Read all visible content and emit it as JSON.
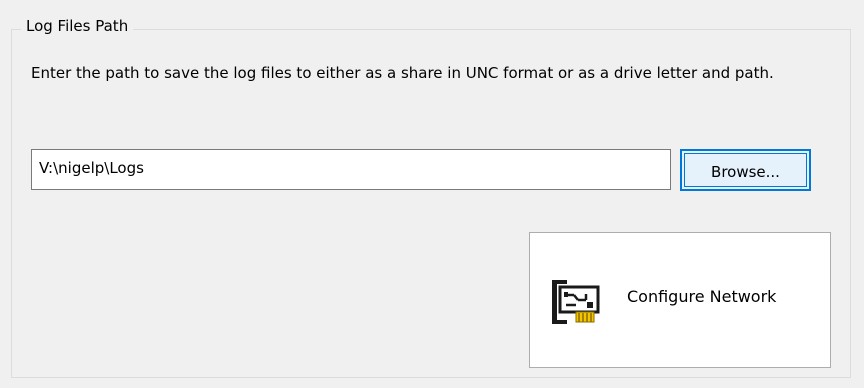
{
  "group": {
    "title": "Log Files Path",
    "description": "Enter the path to save the log files to either as a share in UNC format or as a drive letter and path."
  },
  "path_input": {
    "value": "V:\\nigelp\\Logs"
  },
  "browse_button": {
    "label": "Browse..."
  },
  "configure_button": {
    "label": "Configure Network",
    "icon": "network-card-icon"
  }
}
